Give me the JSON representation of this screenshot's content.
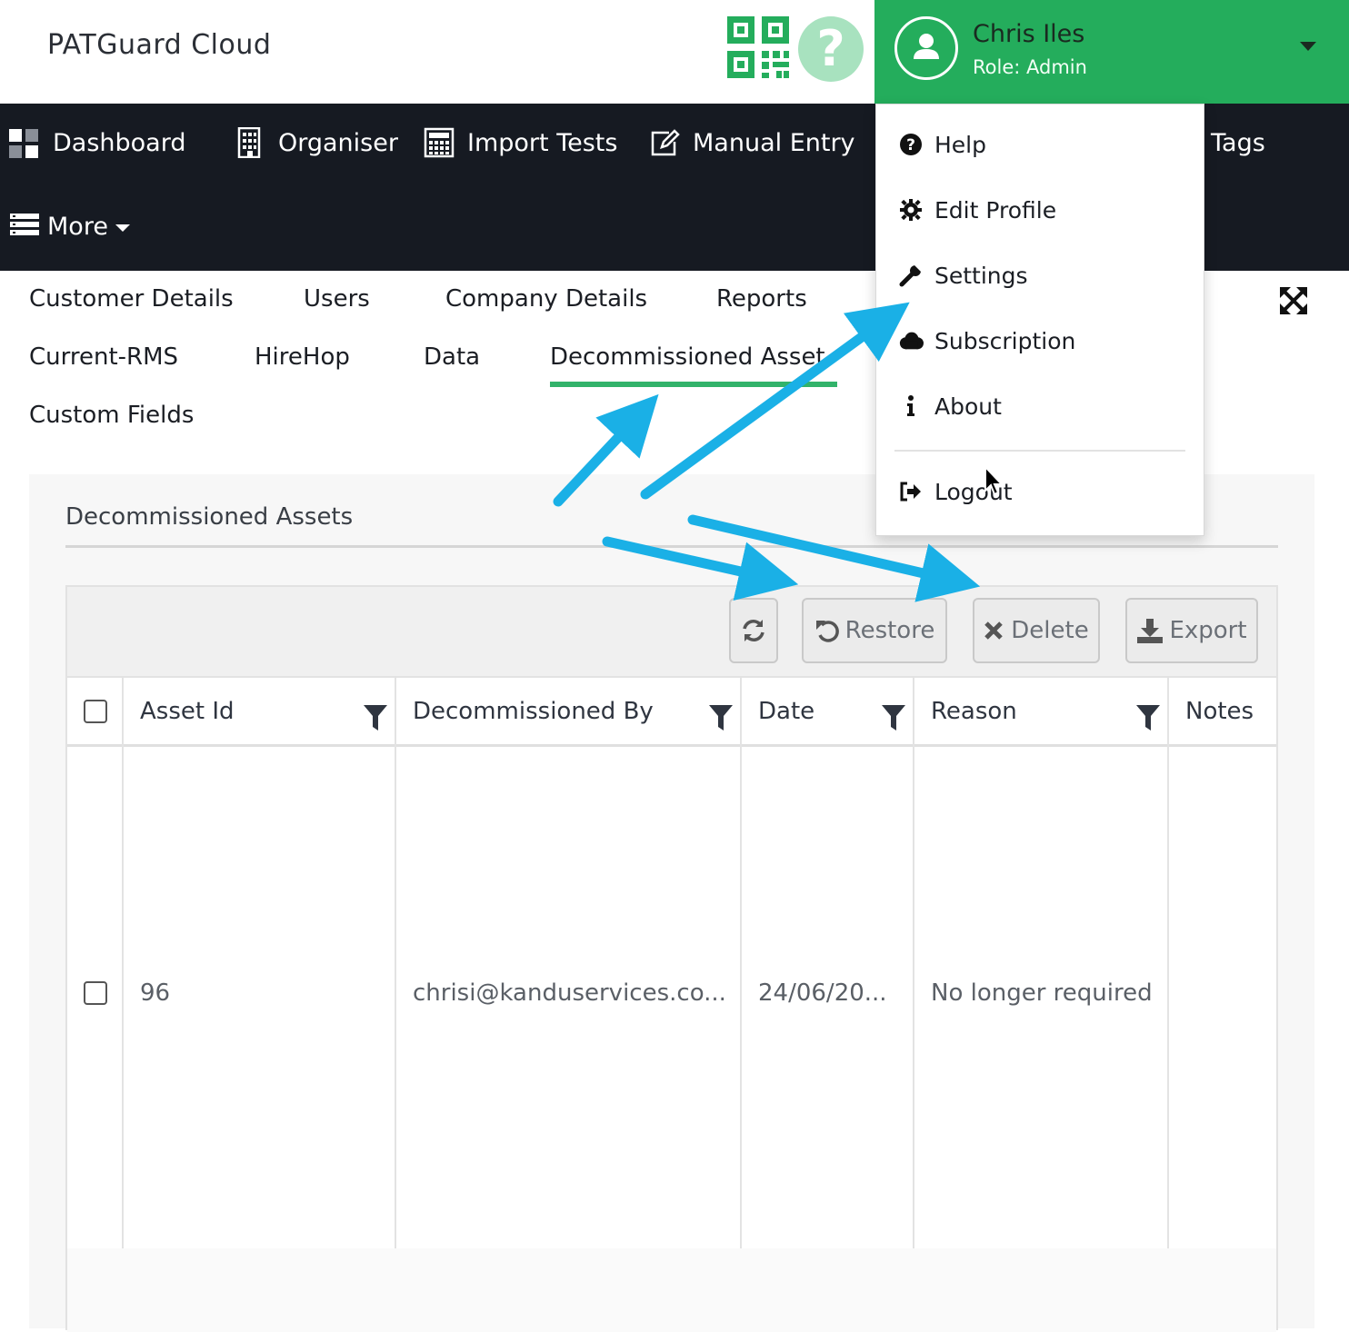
{
  "header": {
    "brand": "PATGuard Cloud",
    "help_glyph": "?",
    "user_name": "Chris Iles",
    "user_role": "Role: Admin"
  },
  "nav": {
    "items": [
      {
        "label": "Dashboard",
        "icon": "dashboard-icon"
      },
      {
        "label": "Organiser",
        "icon": "building-icon"
      },
      {
        "label": "Import Tests",
        "icon": "calculator-icon"
      },
      {
        "label": "Manual Entry",
        "icon": "edit-icon"
      },
      {
        "label": "Tags",
        "icon": ""
      },
      {
        "label": "More",
        "icon": "list-icon"
      }
    ]
  },
  "tabs": [
    {
      "label": "Customer Details"
    },
    {
      "label": "Users"
    },
    {
      "label": "Company Details"
    },
    {
      "label": "Reports"
    },
    {
      "label": "Current-RMS"
    },
    {
      "label": "HireHop"
    },
    {
      "label": "Data"
    },
    {
      "label": "Decommissioned Asset"
    },
    {
      "label": "Custom Fields"
    }
  ],
  "panel": {
    "title": "Decommissioned Assets",
    "toolbar": {
      "refresh_icon": "refresh-icon",
      "restore": "Restore",
      "delete": "Delete",
      "export": "Export"
    },
    "columns": [
      "Asset Id",
      "Decommissioned By",
      "Date",
      "Reason",
      "Notes"
    ],
    "rows": [
      {
        "asset_id": "96",
        "decommissioned_by": "chrisi@kanduservices.co...",
        "date": "24/06/20...",
        "reason": "No longer required",
        "notes": ""
      }
    ]
  },
  "dropdown": {
    "items": [
      {
        "label": "Help",
        "icon": "question-circle-icon"
      },
      {
        "label": "Edit Profile",
        "icon": "gear-icon"
      },
      {
        "label": "Settings",
        "icon": "wrench-icon"
      },
      {
        "label": "Subscription",
        "icon": "cloud-icon"
      },
      {
        "label": "About",
        "icon": "info-icon"
      },
      {
        "label": "Logout",
        "icon": "logout-icon"
      }
    ]
  },
  "colors": {
    "brand_green": "#24ad5c",
    "nav_dark": "#161a22",
    "tab_underline": "#32b36a",
    "annotation_arrow": "#1ab0e6"
  }
}
